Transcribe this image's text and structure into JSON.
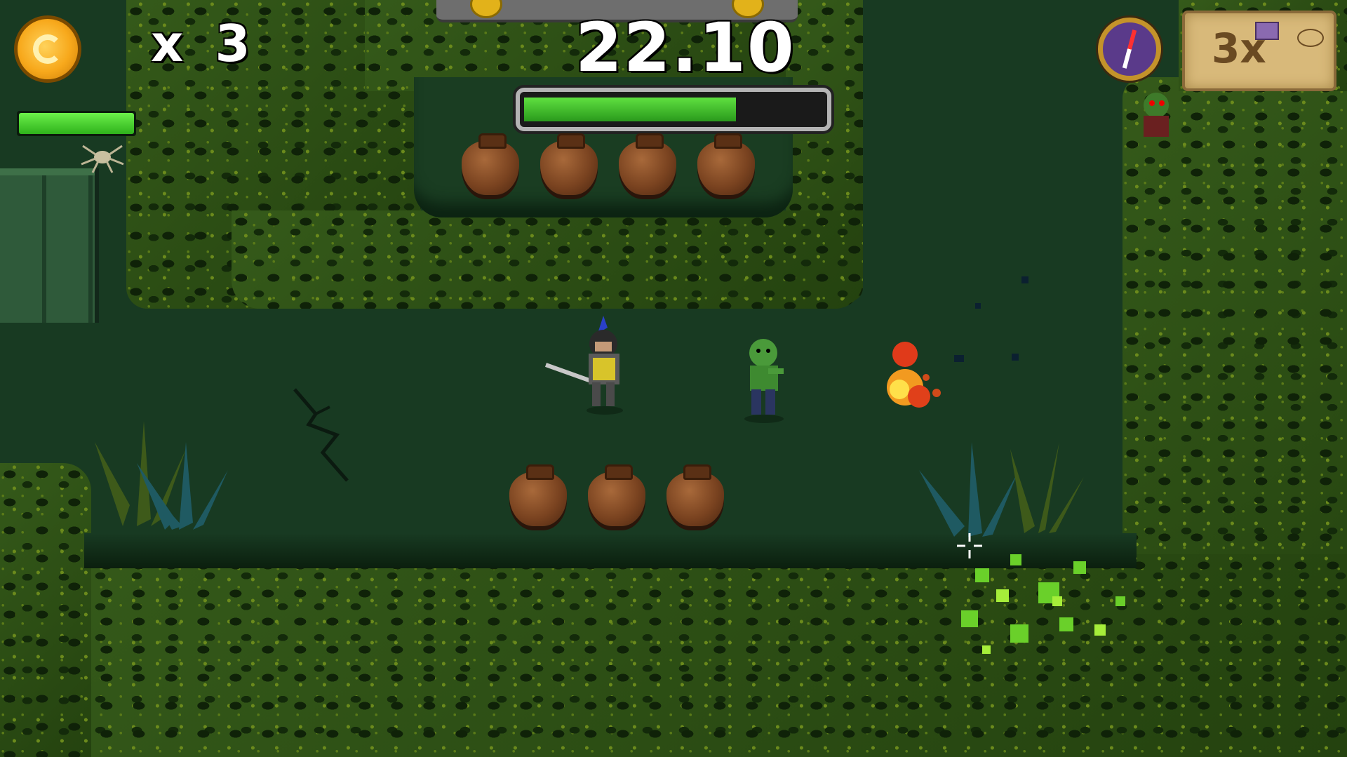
{
  "hud": {
    "coin_icon": "gold-coin-icon",
    "lives_text": "x 3",
    "player_health_fraction": 1.0,
    "timer_text": "22.10",
    "timer_bar_fraction": 0.71,
    "compass_icon": "compass-icon",
    "map_scroll_text": "3x",
    "colors": {
      "health_green": "#3fcf2a",
      "timer_bar_green": "#37b02a",
      "coin_gold": "#f7a81b",
      "scroll_parchment": "#d8b97a"
    }
  },
  "world": {
    "player": "knight-player",
    "enemy": "green-zombie",
    "pots_top_row_count": 4,
    "pots_bottom_row_count": 3
  }
}
